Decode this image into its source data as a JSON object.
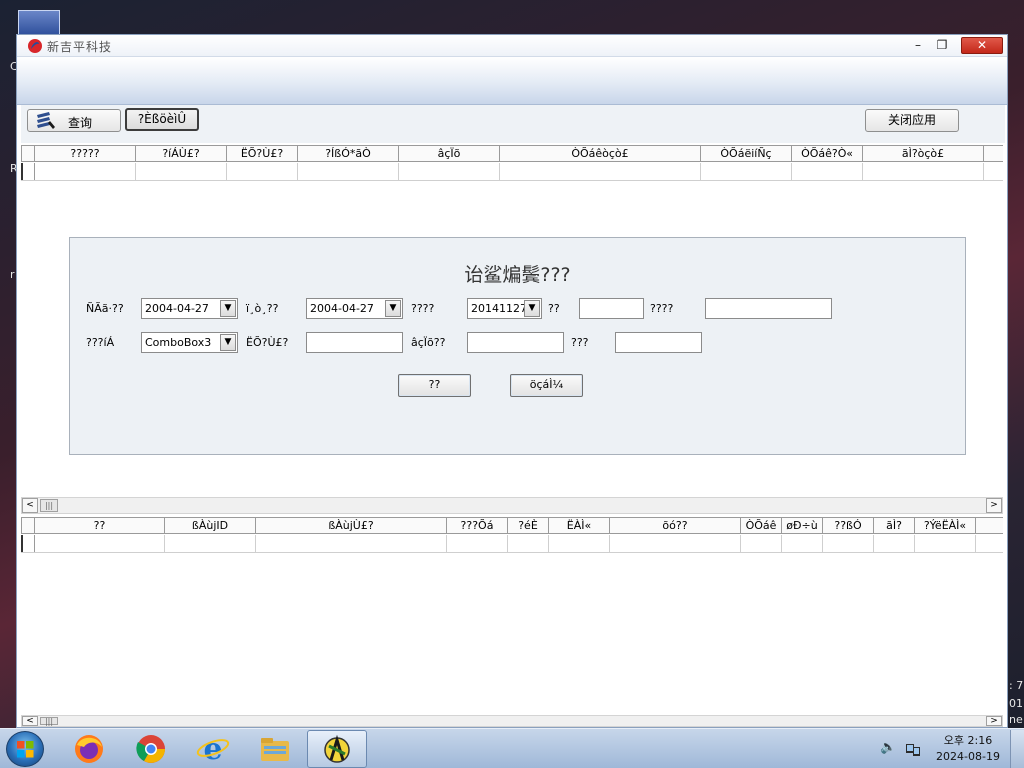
{
  "window": {
    "title": "新吉平科技",
    "controls": {
      "minimize": "–",
      "maximize": "❐",
      "close": "✕"
    }
  },
  "toolbar": {
    "query_label": "查询",
    "second_label": "?ÈßöèìÛ",
    "close_app_label": "关闭应用"
  },
  "top_grid": {
    "columns": [
      "?????",
      "?íÁÙ£?",
      "ËÕ?Ù£?",
      "?ÍßÓ*ãÒ",
      "âçÏõ",
      "ÒÕáêòçò£",
      "ÒÕáëiíÑç",
      "ÒÕáê?Ò«",
      "ãÌ?òçò£"
    ]
  },
  "bottom_grid": {
    "columns": [
      "??",
      "ßÀùjID",
      "ßÀùjÙ£?",
      "???Õá",
      "?éÈ",
      "ËÀÌ«",
      "õó??",
      "ÒÕáê",
      "øÐ÷ù",
      "??ßÓ",
      "ãÌ?",
      "?ÝëËÀÌ«"
    ]
  },
  "dialog": {
    "title": "诒鲨煸鬓???",
    "row1": {
      "label1": "ÑÃã·??",
      "combo1": "2004-04-27",
      "label2": "ï¸ò¸??",
      "combo2": "2004-04-27",
      "label3": "????",
      "combo3": "20141127",
      "label4": "??",
      "label5": "????"
    },
    "row2": {
      "label1": "???íÁ",
      "combo1": "ComboBox3",
      "label2": "ËÕ?Ù£?",
      "label3": "âçÏõ??",
      "label4": "???"
    },
    "buttons": {
      "ok": "??",
      "cancel": "öçáÌ¼"
    }
  },
  "scroll": {
    "left": "<",
    "right": ">",
    "thumb": "|||"
  },
  "desktop_edge": {
    "top": "C",
    "mid1": "R",
    "mid2": "r",
    "right1": ": 7",
    "right2": "01",
    "right3": "ne"
  },
  "taskbar": {
    "time": "오후 2:16",
    "date": "2024-08-19",
    "volume_glyph": "🔈"
  },
  "colors": {
    "close_button": "#c4281a",
    "window_border": "#8aa0be",
    "dialog_bg": "#edf1f5",
    "taskbar": "#b3c7e0"
  }
}
